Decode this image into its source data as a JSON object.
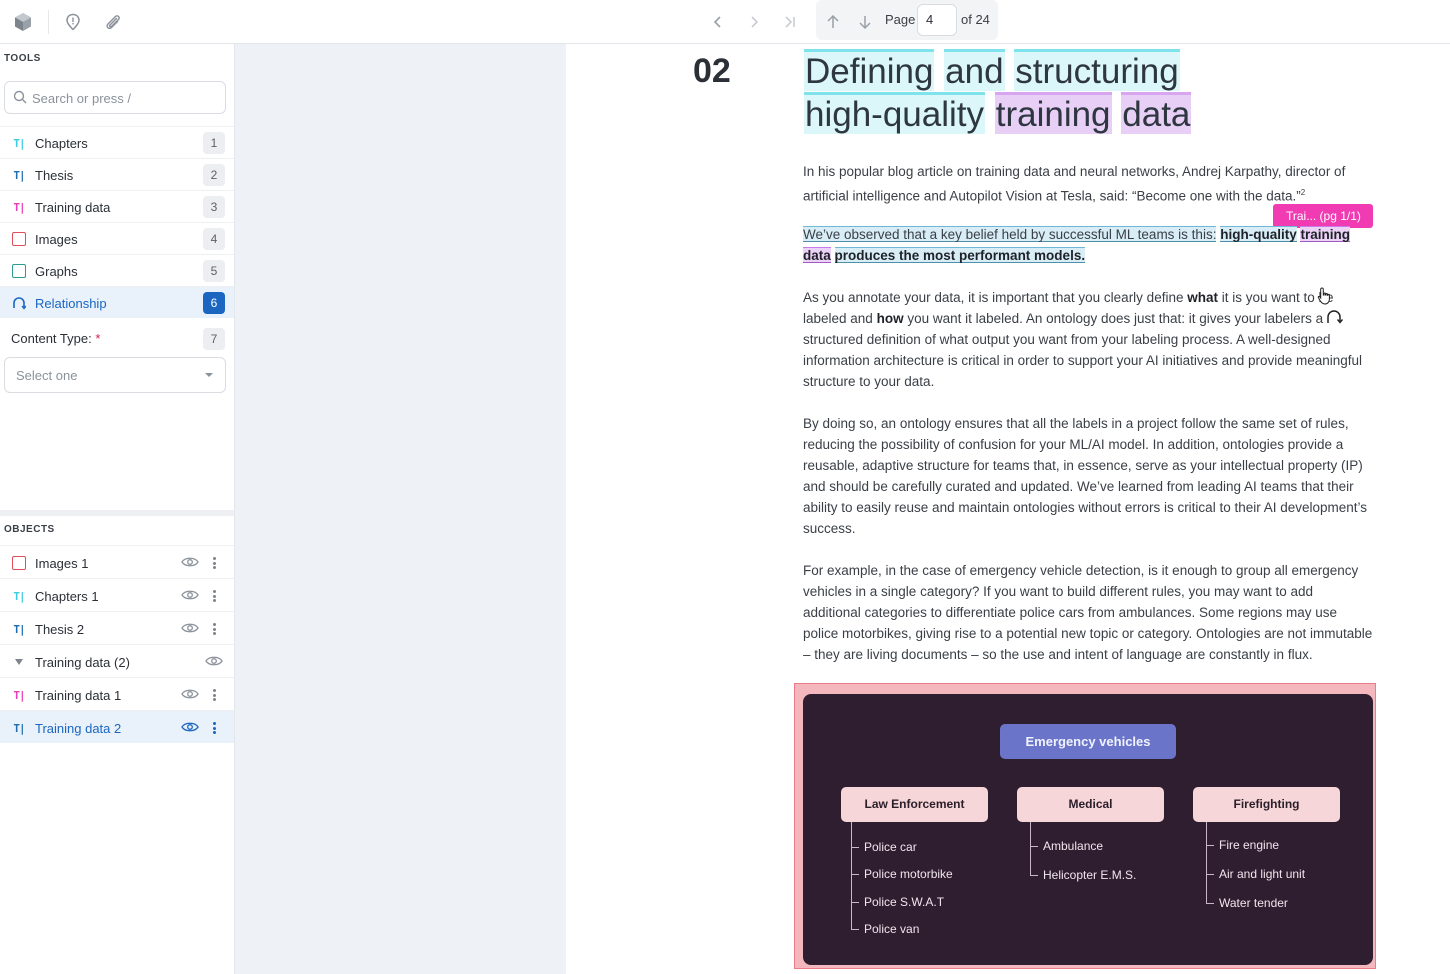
{
  "toolbar": {
    "page_label": "Page",
    "page_value": "4",
    "page_total": "of 24"
  },
  "sidebar": {
    "tools_title": "TOOLS",
    "search_placeholder": "Search or press /",
    "tools": [
      {
        "label": "Chapters",
        "shortcut": "1",
        "icon": "text-tool-icon",
        "color": "#3fcde0"
      },
      {
        "label": "Thesis",
        "shortcut": "2",
        "icon": "text-tool-icon",
        "color": "#1f6fb0"
      },
      {
        "label": "Training data",
        "shortcut": "3",
        "icon": "text-tool-icon",
        "color": "#e83fb6"
      },
      {
        "label": "Images",
        "shortcut": "4",
        "icon": "bounding-box-icon",
        "color": "#e0505a"
      },
      {
        "label": "Graphs",
        "shortcut": "5",
        "icon": "bounding-box-icon",
        "color": "#2f9a8f"
      },
      {
        "label": "Relationship",
        "shortcut": "6",
        "icon": "relationship-icon",
        "color": "#1a66c0"
      }
    ],
    "content_type_label": "Content Type:",
    "content_type_required": "*",
    "content_type_shortcut": "7",
    "content_type_placeholder": "Select one",
    "objects_title": "OBJECTS",
    "objects": [
      {
        "label": "Images 1",
        "icon": "bounding-box-icon",
        "color": "#e0505a"
      },
      {
        "label": "Chapters 1",
        "icon": "text-tool-icon",
        "color": "#3fcde0"
      },
      {
        "label": "Thesis 2",
        "icon": "text-tool-icon",
        "color": "#1f6fb0"
      },
      {
        "label": "Training data (2)",
        "icon": "caret-down-icon",
        "color": "#7d848c"
      },
      {
        "label": "Training data 1",
        "icon": "text-tool-icon",
        "color": "#e83fb6"
      },
      {
        "label": "Training data 2",
        "icon": "text-tool-icon",
        "color": "#1f6fb0"
      }
    ]
  },
  "document": {
    "chapter_number": "02",
    "title_line1": [
      "Defining",
      "and",
      "structuring"
    ],
    "title_line2": [
      "high-quality",
      "training",
      "data"
    ],
    "para1": "In his popular blog article on training data and neural networks, Andrej Karpathy, director of artificial intelligence and Autopilot Vision at Tesla, said: “Become one with the data.”",
    "para1_sup": "2",
    "tag_label": "Trai... (pg 1/1)",
    "para2_plain": "We’ve observed that a key belief held by successful ML teams is this:",
    "para2_bold": "high-quality",
    "para2_bold2": "training",
    "para2_bold3": "data",
    "para2_tail": "produces the most performant models.",
    "para3_a": "As you annotate your data, it is important that you clearly define ",
    "para3_what": "what",
    "para3_b": " it is you want to be labeled and ",
    "para3_how": "how",
    "para3_c": " you want it labeled. An ontology does just that: it gives your labelers a structured definition of what output you want from your labeling process. A well-designed information architecture is critical in order to support your AI initiatives and provide meaningful structure to your data.",
    "para4": "By doing so, an ontology ensures that all the labels in a project follow the same set of rules, reducing the possibility of confusion for your ML/AI model. In addition, ontologies provide a reusable, adaptive structure for teams that, in essence, serve as your intellectual property (IP) and should be carefully curated and updated. We’ve learned from leading AI teams that their ability to easily reuse and maintain ontologies without errors is critical to their AI development’s success.",
    "para5": "For example, in the case of emergency vehicle detection, is it enough to group all emergency vehicles in a single category? If you want to build different rules, you may want to add additional categories to differentiate police cars from ambulances. Some regions may use police motorbikes, giving rise to a potential new topic or category. Ontologies are not immutable – they are living documents – so the use and intent of language are constantly in flux."
  },
  "diagram": {
    "root": "Emergency vehicles",
    "categories": [
      {
        "label": "Law Enforcement",
        "items": [
          "Police car",
          "Police motorbike",
          "Police S.W.A.T",
          "Police van"
        ]
      },
      {
        "label": "Medical",
        "items": [
          "Ambulance",
          "Helicopter E.M.S."
        ]
      },
      {
        "label": "Firefighting",
        "items": [
          "Fire engine",
          "Air and light unit",
          "Water tender"
        ]
      }
    ]
  }
}
